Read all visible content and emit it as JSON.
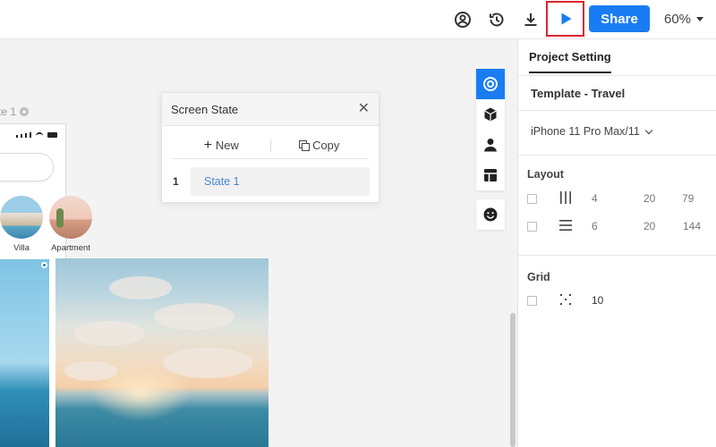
{
  "toolbar": {
    "icons": [
      "user-circle-icon",
      "history-icon",
      "download-icon",
      "play-icon"
    ],
    "share_label": "Share",
    "zoom": "60%",
    "accent": "#1a7cf2",
    "highlight": "#d9262f"
  },
  "canvas": {
    "frame_label": "te 1",
    "categories": [
      {
        "label": "Villa"
      },
      {
        "label": "Apartment"
      }
    ]
  },
  "screen_state": {
    "title": "Screen State",
    "new_label": "New",
    "copy_label": "Copy",
    "states": [
      {
        "index": "1",
        "name": "State 1"
      }
    ]
  },
  "tool_strip": [
    "target-icon",
    "cube-icon",
    "person-icon",
    "layout-icon",
    "emoji-icon"
  ],
  "panel": {
    "tab": "Project Setting",
    "template": "Template - Travel",
    "device": "iPhone 11 Pro Max/11",
    "layout": {
      "title": "Layout",
      "rows": [
        {
          "icon": "columns-icon",
          "count": "4",
          "gutter": "20",
          "size": "79"
        },
        {
          "icon": "rows-icon",
          "count": "6",
          "gutter": "20",
          "size": "144"
        }
      ]
    },
    "grid": {
      "title": "Grid",
      "size": "10"
    }
  }
}
